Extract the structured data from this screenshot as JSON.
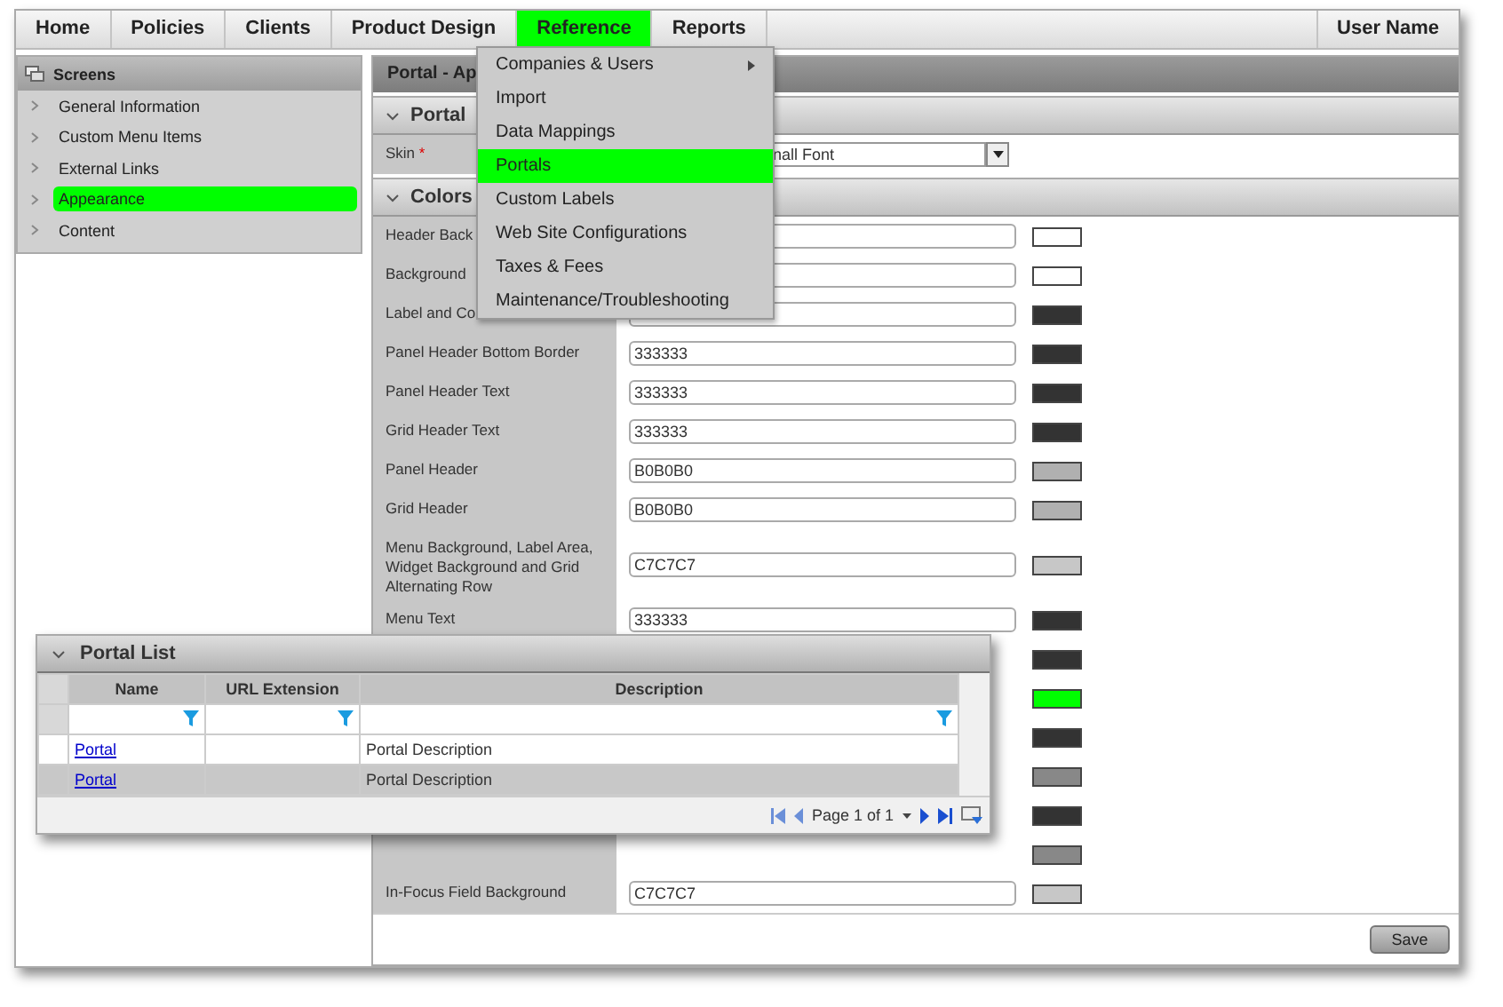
{
  "nav": {
    "items": [
      {
        "label": "Home",
        "selected": false
      },
      {
        "label": "Policies",
        "selected": false
      },
      {
        "label": "Clients",
        "selected": false
      },
      {
        "label": "Product Design",
        "selected": false
      },
      {
        "label": "Reference",
        "selected": true
      },
      {
        "label": "Reports",
        "selected": false
      }
    ],
    "user": "User Name"
  },
  "sidebar": {
    "title": "Screens",
    "items": [
      {
        "label": "General Information",
        "selected": false
      },
      {
        "label": "Custom Menu Items",
        "selected": false
      },
      {
        "label": "External Links",
        "selected": false
      },
      {
        "label": "Appearance",
        "selected": true
      },
      {
        "label": "Content",
        "selected": false
      }
    ]
  },
  "main": {
    "title": "Portal - Ap",
    "portal_section": {
      "title": "Portal",
      "skin": {
        "label": "Skin",
        "mark": "*",
        "value": "nall Font"
      }
    },
    "colors_section": {
      "title": "Colors",
      "rows": [
        {
          "label": "Header Back",
          "color": "#ffffff"
        },
        {
          "label": "Background",
          "color": "#ffffff"
        },
        {
          "label": "Label and Co",
          "color": "#333333"
        },
        {
          "label": "Panel Header Bottom Border",
          "value": "333333",
          "color": "#333333"
        },
        {
          "label": "Panel Header Text",
          "value": "333333",
          "color": "#333333"
        },
        {
          "label": "Grid Header Text",
          "value": "333333",
          "color": "#333333"
        },
        {
          "label": "Panel Header",
          "value": "B0B0B0",
          "color": "#b0b0b0"
        },
        {
          "label": "Grid Header",
          "value": "B0B0B0",
          "color": "#b0b0b0"
        },
        {
          "label": "Menu Background, Label Area, Widget Background and Grid Alternating Row",
          "value": "C7C7C7",
          "color": "#c7c7c7"
        },
        {
          "label": "Menu Text",
          "value": "333333",
          "color": "#333333"
        },
        {
          "color": "#333333"
        },
        {
          "color": "#00ff00"
        },
        {
          "color": "#333333"
        },
        {
          "color": "#888888"
        },
        {
          "color": "#333333"
        },
        {
          "color": "#888888"
        },
        {
          "label": "In-Focus Field Background",
          "value": "C7C7C7",
          "color": "#c7c7c7"
        }
      ]
    },
    "save": "Save"
  },
  "menu": {
    "items": [
      {
        "label": "Companies & Users",
        "submenu": true,
        "selected": false
      },
      {
        "label": "Import",
        "submenu": false,
        "selected": false
      },
      {
        "label": "Data Mappings",
        "submenu": false,
        "selected": false
      },
      {
        "label": "Portals",
        "submenu": false,
        "selected": true
      },
      {
        "label": "Custom Labels",
        "submenu": false,
        "selected": false
      },
      {
        "label": "Web Site Configurations",
        "submenu": false,
        "selected": false
      },
      {
        "label": "Taxes & Fees",
        "submenu": false,
        "selected": false
      },
      {
        "label": "Maintenance/Troubleshooting",
        "submenu": false,
        "selected": false
      }
    ]
  },
  "portal_list": {
    "title": "Portal List",
    "columns": [
      "Name",
      "URL Extension",
      "Description"
    ],
    "rows": [
      {
        "name": "Portal",
        "description": "Portal Description"
      },
      {
        "name": "Portal",
        "description": "Portal Description"
      }
    ],
    "pager": "Page 1 of 1"
  }
}
